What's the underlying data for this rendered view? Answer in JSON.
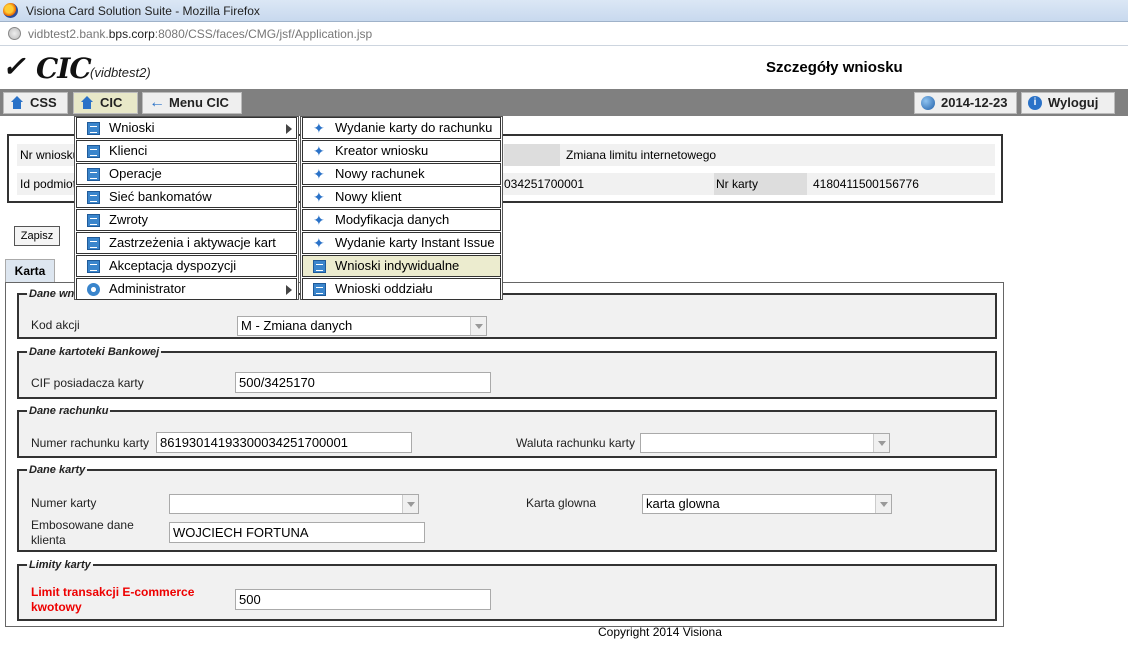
{
  "browser": {
    "window_title": "Visiona Card Solution Suite - Mozilla Firefox",
    "url_prefix": "vidbtest2.bank.",
    "url_domain": "bps.corp",
    "url_rest": ":8080/CSS/faces/CMG/jsf/Application.jsp"
  },
  "header": {
    "logo_text": "CIC",
    "environment": "(vidbtest2)",
    "page_title": "Szczegóły wniosku"
  },
  "navbar": {
    "css_label": "CSS",
    "cic_label": "CIC",
    "menu_cic_label": "Menu CIC",
    "date": "2014-12-23",
    "logout_label": "Wyloguj"
  },
  "info": {
    "nr_wniosku_label": "Nr wniosku",
    "type_value": "Zmiana limitu internetowego",
    "id_podmiotu_label": "Id podmiotu",
    "account_partial": "034251700001",
    "nr_karty_label": "Nr karty",
    "nr_karty_value": "4180411500156776"
  },
  "actions": {
    "save_label": "Zapisz"
  },
  "tabs": {
    "karta": "Karta"
  },
  "groups": {
    "dane_wniosku": {
      "legend": "Dane wniosku",
      "kod_akcji_label": "Kod akcji",
      "kod_akcji_value": "M - Zmiana danych"
    },
    "dane_kartoteki": {
      "legend": "Dane kartoteki Bankowej",
      "cif_label": "CIF posiadacza karty",
      "cif_value": "500/3425170"
    },
    "dane_rachunku": {
      "legend": "Dane rachunku",
      "numer_label": "Numer rachunku karty",
      "numer_value": "86193014193300034251700001",
      "waluta_label": "Waluta rachunku karty",
      "waluta_value": ""
    },
    "dane_karty": {
      "legend": "Dane karty",
      "numer_karty_label": "Numer karty",
      "numer_karty_value": "",
      "karta_glowna_label": "Karta glowna",
      "karta_glowna_value": "karta glowna",
      "embos_label": "Embosowane dane klienta",
      "embos_value": "WOJCIECH FORTUNA"
    },
    "limity_karty": {
      "legend": "Limity karty",
      "limit_label": "Limit transakcji E-commerce kwotowy",
      "limit_value": "500"
    }
  },
  "cic_menu": [
    {
      "label": "Wnioski",
      "icon": "document-icon",
      "has_submenu": true
    },
    {
      "label": "Klienci",
      "icon": "document-icon"
    },
    {
      "label": "Operacje",
      "icon": "document-icon"
    },
    {
      "label": "Sieć bankomatów",
      "icon": "document-icon"
    },
    {
      "label": "Zwroty",
      "icon": "document-icon"
    },
    {
      "label": "Zastrzeżenia i aktywacje kart",
      "icon": "document-icon"
    },
    {
      "label": "Akceptacja dyspozycji",
      "icon": "document-icon"
    },
    {
      "label": "Administrator",
      "icon": "gear-icon",
      "has_submenu": true
    }
  ],
  "wnioski_submenu": [
    {
      "label": "Wydanie karty do rachunku",
      "icon": "tools-icon"
    },
    {
      "label": "Kreator wniosku",
      "icon": "tools-icon"
    },
    {
      "label": "Nowy rachunek",
      "icon": "tools-icon"
    },
    {
      "label": "Nowy klient",
      "icon": "tools-icon"
    },
    {
      "label": "Modyfikacja danych",
      "icon": "tools-icon"
    },
    {
      "label": "Wydanie karty Instant Issue",
      "icon": "tools-icon"
    },
    {
      "label": "Wnioski indywidualne",
      "icon": "document-icon",
      "highlighted": true
    },
    {
      "label": "Wnioski oddziału",
      "icon": "document-icon"
    }
  ],
  "footer": {
    "copyright": "Copyright 2014 Visiona"
  }
}
